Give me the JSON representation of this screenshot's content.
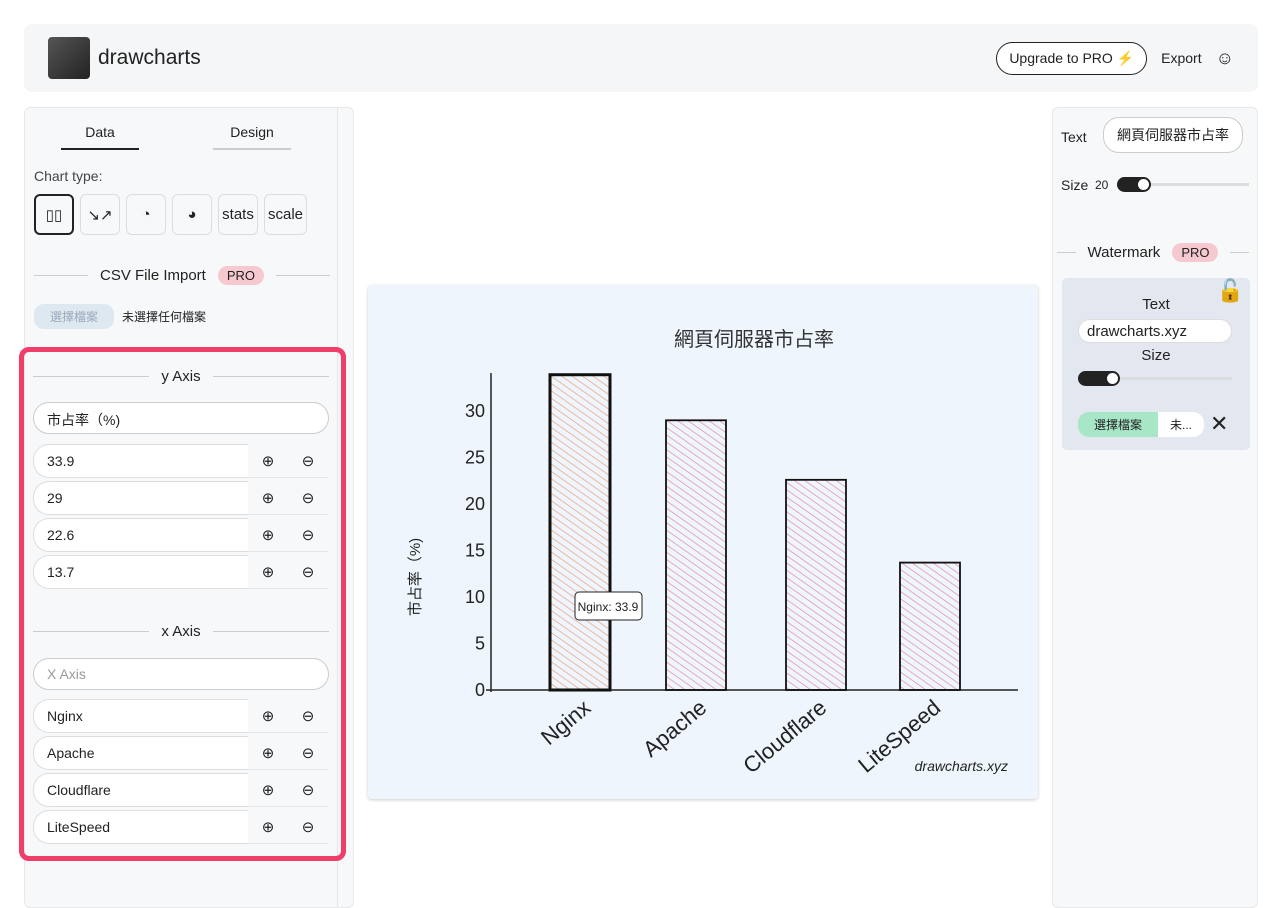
{
  "header": {
    "brand": "drawcharts",
    "upgrade": "Upgrade to PRO ⚡",
    "export": "Export"
  },
  "left": {
    "tabs": [
      "Data",
      "Design"
    ],
    "chart_type_label": "Chart type:",
    "chart_types": [
      "bar",
      "line",
      "pie",
      "donut",
      "stats",
      "scale"
    ],
    "csv": {
      "title": "CSV File Import",
      "pro": "PRO",
      "file_button": "選擇檔案",
      "file_status": "未選擇任何檔案"
    },
    "y_axis": {
      "title": "y Axis",
      "label": "市占率（%)",
      "values": [
        "33.9",
        "29",
        "22.6",
        "13.7"
      ]
    },
    "x_axis": {
      "title": "x Axis",
      "placeholder": "X Axis",
      "values": [
        "Nginx",
        "Apache",
        "Cloudflare",
        "LiteSpeed"
      ]
    }
  },
  "right": {
    "text_label": "Text",
    "text_value": "網頁伺服器市占率",
    "size_label": "Size",
    "size_value": "20",
    "watermark": {
      "title": "Watermark",
      "pro": "PRO",
      "text_label": "Text",
      "text_value": "drawcharts.xyz",
      "size_label": "Size",
      "file_button": "選擇檔案",
      "file_status": "未..."
    }
  },
  "chart_data": {
    "type": "bar",
    "title": "網頁伺服器市占率",
    "ylabel": "市占率（%)",
    "xlabel": "",
    "categories": [
      "Nginx",
      "Apache",
      "Cloudflare",
      "LiteSpeed"
    ],
    "values": [
      33.9,
      29,
      22.6,
      13.7
    ],
    "yticks": [
      0,
      5,
      10,
      15,
      20,
      25,
      30
    ],
    "ylim": [
      0,
      34
    ],
    "colors": [
      "#e8a07a",
      "#e68aa0",
      "#e68aa0",
      "#e68aa0"
    ],
    "tooltip": "Nginx: 33.9",
    "watermark": "drawcharts.xyz",
    "grid": false
  }
}
